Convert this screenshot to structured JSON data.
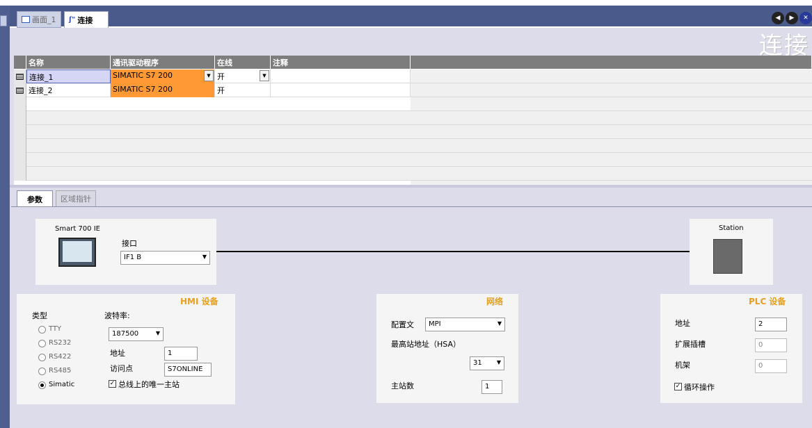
{
  "tabs": {
    "screen_tab": "画面_1",
    "connections_tab": "连接"
  },
  "page_title": "连接",
  "table": {
    "columns": [
      "名称",
      "通讯驱动程序",
      "在线",
      "注释"
    ],
    "rows": [
      {
        "name": "连接_1",
        "driver": "SIMATIC S7 200",
        "online": "开",
        "comment": ""
      },
      {
        "name": "连接_2",
        "driver": "SIMATIC S7 200",
        "online": "开",
        "comment": ""
      }
    ]
  },
  "subtabs": {
    "params": "参数",
    "area_pointer": "区域指针"
  },
  "hmi_device": {
    "name": "Smart 700 IE",
    "interface_label": "接口",
    "interface_value": "IF1 B"
  },
  "station": {
    "name": "Station"
  },
  "hmi_panel": {
    "title": "HMI 设备",
    "type_label": "类型",
    "types": [
      "TTY",
      "RS232",
      "RS422",
      "RS485",
      "Simatic"
    ],
    "selected_type": "Simatic",
    "baud_label": "波特率:",
    "baud_value": "187500",
    "address_label": "地址",
    "address_value": "1",
    "access_point_label": "访问点",
    "access_point_value": "S7ONLINE",
    "only_master_label": "总线上的唯一主站"
  },
  "network_panel": {
    "title": "网络",
    "profile_label": "配置文",
    "profile_value": "MPI",
    "hsa_label": "最高站地址（HSA）",
    "hsa_value": "31",
    "masters_label": "主站数",
    "masters_value": "1"
  },
  "plc_panel": {
    "title": "PLC 设备",
    "address_label": "地址",
    "address_value": "2",
    "slot_label": "扩展插槽",
    "slot_value": "0",
    "rack_label": "机架",
    "rack_value": "0",
    "cyclic_label": "循环操作"
  },
  "colors": {
    "driver_highlight": "#ff9933",
    "panel_title": "#e8a020",
    "tabbar": "#4a5a8a"
  }
}
